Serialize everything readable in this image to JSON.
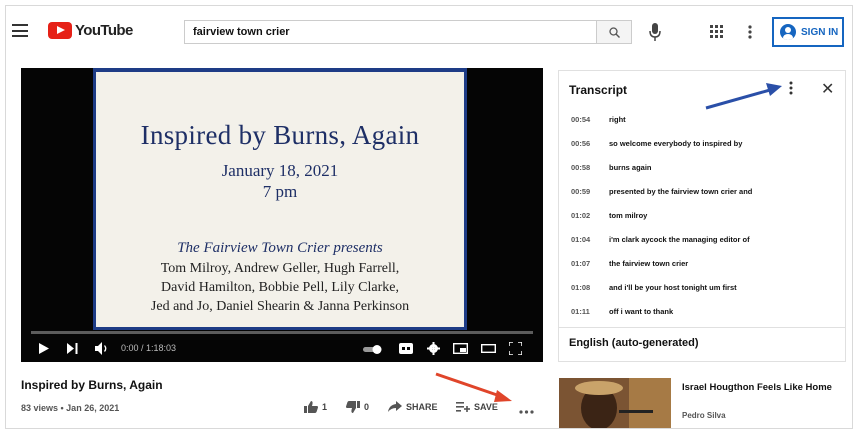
{
  "header": {
    "logo_text": "YouTube",
    "search_value": "fairview town crier",
    "signin_label": "SIGN IN"
  },
  "slide": {
    "title": "Inspired by Burns, Again",
    "date": "January 18, 2021",
    "time": "7 pm",
    "presents": "The Fairview Town Crier presents",
    "names": [
      "Tom Milroy, Andrew Geller, Hugh Farrell,",
      "David Hamilton, Bobbie Pell, Lily Clarke,",
      "Jed and Jo, Daniel Shearin & Janna Perkinson"
    ]
  },
  "player": {
    "time": "0:00 / 1:18:03"
  },
  "transcript": {
    "title": "Transcript",
    "language": "English (auto-generated)",
    "rows": [
      {
        "ts": "00:54",
        "text": "right"
      },
      {
        "ts": "00:56",
        "text": "so welcome everybody to inspired by"
      },
      {
        "ts": "00:58",
        "text": "burns again"
      },
      {
        "ts": "00:59",
        "text": "presented by the fairview town crier and"
      },
      {
        "ts": "01:02",
        "text": "tom milroy"
      },
      {
        "ts": "01:04",
        "text": "i'm clark aycock the managing editor of"
      },
      {
        "ts": "01:07",
        "text": "the fairview town crier"
      },
      {
        "ts": "01:08",
        "text": "and i'll be your host tonight um first"
      },
      {
        "ts": "01:11",
        "text": "off i want to thank"
      }
    ]
  },
  "video": {
    "title": "Inspired by Burns, Again",
    "meta": "83 views • Jan 26, 2021",
    "likes": "1",
    "dislikes": "0",
    "share_label": "SHARE",
    "save_label": "SAVE"
  },
  "related": {
    "title": "Israel Hougthon Feels Like Home",
    "channel": "Pedro Silva"
  },
  "colors": {
    "brand_red": "#e62117",
    "signin_blue": "#1565c0",
    "arrow_blue": "#2a4fa8",
    "arrow_red": "#e0452a",
    "slide_navy": "#1e2f66"
  }
}
